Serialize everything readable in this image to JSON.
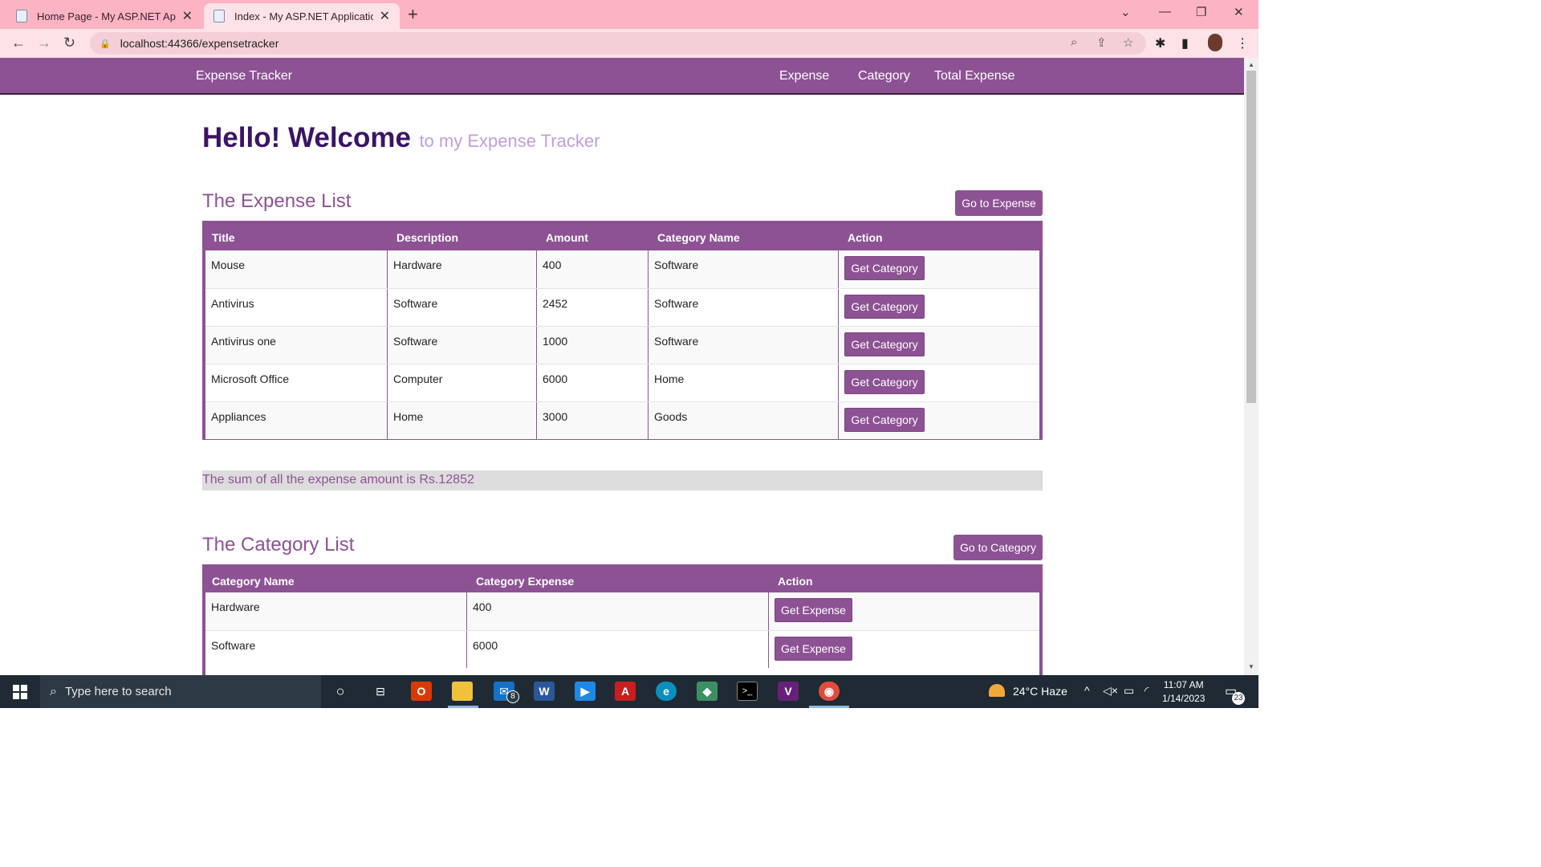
{
  "browser": {
    "tabs": [
      {
        "title": "Home Page - My ASP.NET Applic",
        "active": false
      },
      {
        "title": "Index - My ASP.NET Application",
        "active": true
      }
    ],
    "address": "localhost:44366/expensetracker"
  },
  "navbar": {
    "brand": "Expense Tracker",
    "links": [
      "Expense",
      "Category",
      "Total Expense"
    ]
  },
  "hero": {
    "title": "Hello! Welcome",
    "subtitle": "to my Expense Tracker"
  },
  "expense_section": {
    "title": "The Expense List",
    "go_button": "Go to Expense",
    "columns": [
      "Title",
      "Description",
      "Amount",
      "Category Name",
      "Action"
    ],
    "rows": [
      {
        "title": "Mouse",
        "description": "Hardware",
        "amount": "400",
        "category": "Software",
        "action": "Get Category"
      },
      {
        "title": "Antivirus",
        "description": "Software",
        "amount": "2452",
        "category": "Software",
        "action": "Get Category"
      },
      {
        "title": "Antivirus one",
        "description": "Software",
        "amount": "1000",
        "category": "Software",
        "action": "Get Category"
      },
      {
        "title": "Microsoft Office",
        "description": "Computer",
        "amount": "6000",
        "category": "Home",
        "action": "Get Category"
      },
      {
        "title": "Appliances",
        "description": "Home",
        "amount": "3000",
        "category": "Goods",
        "action": "Get Category"
      }
    ]
  },
  "sum_text": "The sum of all the expense amount is Rs.12852",
  "category_section": {
    "title": "The Category List",
    "go_button": "Go to Category",
    "columns": [
      "Category Name",
      "Category Expense",
      "Action"
    ],
    "rows": [
      {
        "name": "Hardware",
        "expense": "400",
        "action": "Get Expense"
      },
      {
        "name": "Software",
        "expense": "6000",
        "action": "Get Expense"
      }
    ]
  },
  "taskbar": {
    "search_placeholder": "Type here to search",
    "mail_badge": "8",
    "weather": "24°C  Haze",
    "time": "11:07 AM",
    "date": "1/14/2023",
    "notification_count": "23"
  },
  "colors": {
    "brand_purple": "#8d5294",
    "hero_dark": "#3b1466",
    "hero_light": "#c09fd9",
    "tab_strip": "#fcb3c4"
  }
}
